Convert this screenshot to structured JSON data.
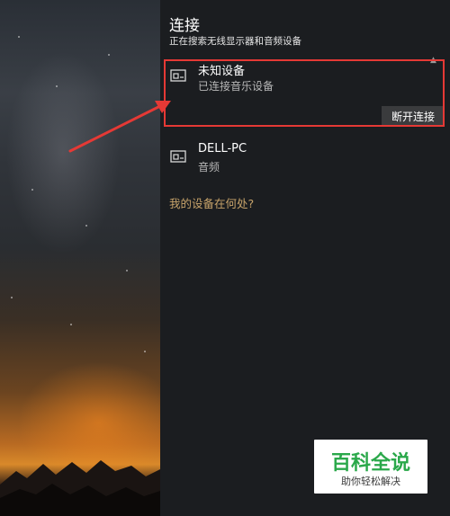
{
  "panel": {
    "title": "连接",
    "subtitle": "正在搜索无线显示器和音频设备",
    "devices": [
      {
        "name": "未知设备",
        "status": "已连接音乐设备",
        "action_label": "断开连接",
        "icon": "display-device-icon"
      },
      {
        "name": "DELL-PC",
        "status": "音频",
        "icon": "display-device-icon"
      }
    ],
    "where_link": "我的设备在何处?"
  },
  "annotation": {
    "color": "#e53935"
  },
  "watermark": {
    "main": "百科全说",
    "sub": "助你轻松解决"
  }
}
